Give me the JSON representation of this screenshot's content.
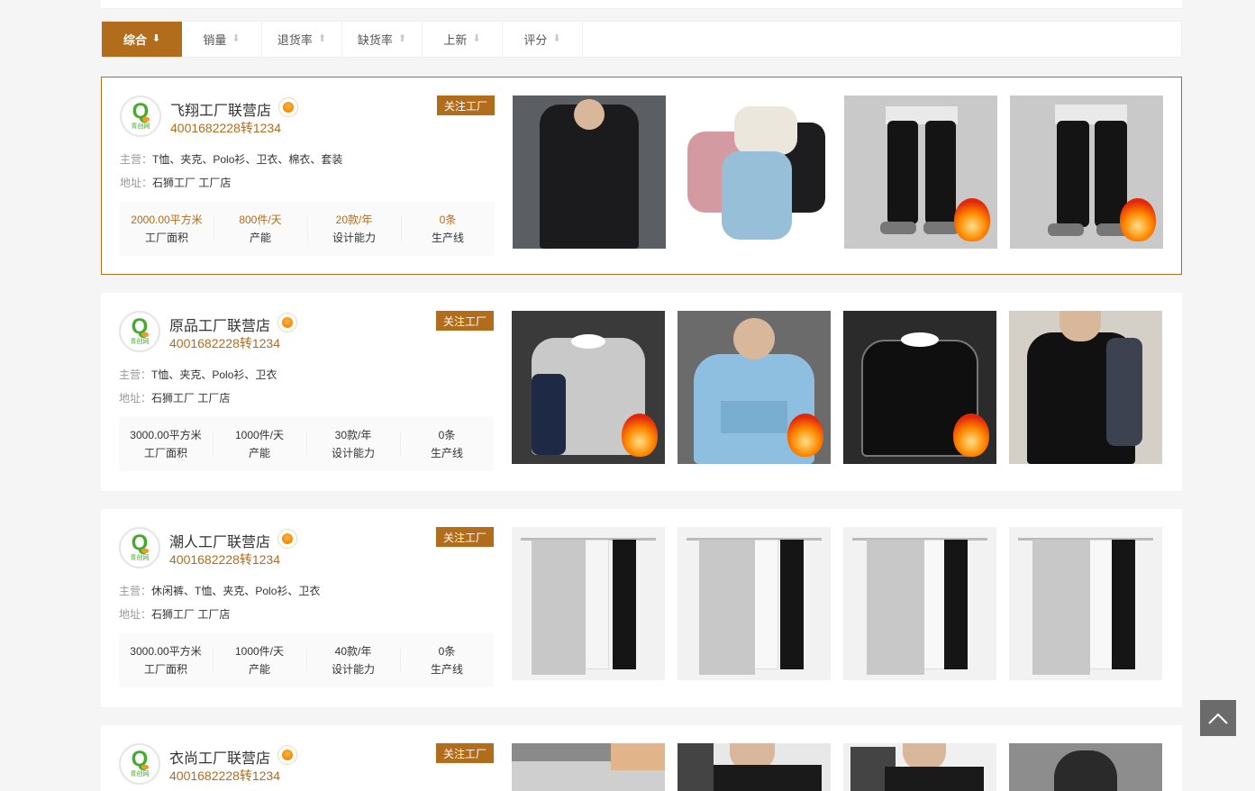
{
  "sort_bar": {
    "items": [
      {
        "label": "综合",
        "arrow": "⬇",
        "active": true
      },
      {
        "label": "销量",
        "arrow": "⬇",
        "active": false
      },
      {
        "label": "退货率",
        "arrow": "⬆",
        "active": false
      },
      {
        "label": "缺货率",
        "arrow": "⬆",
        "active": false
      },
      {
        "label": "上新",
        "arrow": "⬇",
        "active": false
      },
      {
        "label": "评分",
        "arrow": "⬇",
        "active": false
      }
    ]
  },
  "accent_color": "#b16c1c",
  "logo": {
    "letter": "Q",
    "text": "青创网"
  },
  "factories": [
    {
      "name": "飞翔工厂联营店",
      "phone": "4001682228转1234",
      "follow_label": "关注工厂",
      "main_label": "主营：",
      "main_value": "T恤、夹克、Polo衫、卫衣、棉衣、套装",
      "addr_label": "地址：",
      "addr_value": "石狮工厂 工厂店",
      "stats": [
        {
          "value": "2000.00平方米",
          "label": "工厂面积"
        },
        {
          "value": "800件/天",
          "label": "产能"
        },
        {
          "value": "20款/年",
          "label": "设计能力"
        },
        {
          "value": "0条",
          "label": "生产线"
        }
      ]
    },
    {
      "name": "原品工厂联营店",
      "phone": "4001682228转1234",
      "follow_label": "关注工厂",
      "main_label": "主营：",
      "main_value": "T恤、夹克、Polo衫、卫衣",
      "addr_label": "地址：",
      "addr_value": "石狮工厂 工厂店",
      "stats": [
        {
          "value": "3000.00平方米",
          "label": "工厂面积"
        },
        {
          "value": "1000件/天",
          "label": "产能"
        },
        {
          "value": "30款/年",
          "label": "设计能力"
        },
        {
          "value": "0条",
          "label": "生产线"
        }
      ]
    },
    {
      "name": "潮人工厂联营店",
      "phone": "4001682228转1234",
      "follow_label": "关注工厂",
      "main_label": "主营：",
      "main_value": "休闲裤、T恤、夹克、Polo衫、卫衣",
      "addr_label": "地址：",
      "addr_value": "石狮工厂 工厂店",
      "stats": [
        {
          "value": "3000.00平方米",
          "label": "工厂面积"
        },
        {
          "value": "1000件/天",
          "label": "产能"
        },
        {
          "value": "40款/年",
          "label": "设计能力"
        },
        {
          "value": "0条",
          "label": "生产线"
        }
      ]
    },
    {
      "name": "衣尚工厂联营店",
      "phone": "4001682228转1234",
      "follow_label": "关注工厂"
    }
  ],
  "back_to_top": {
    "icon": "chevron-up-icon"
  }
}
